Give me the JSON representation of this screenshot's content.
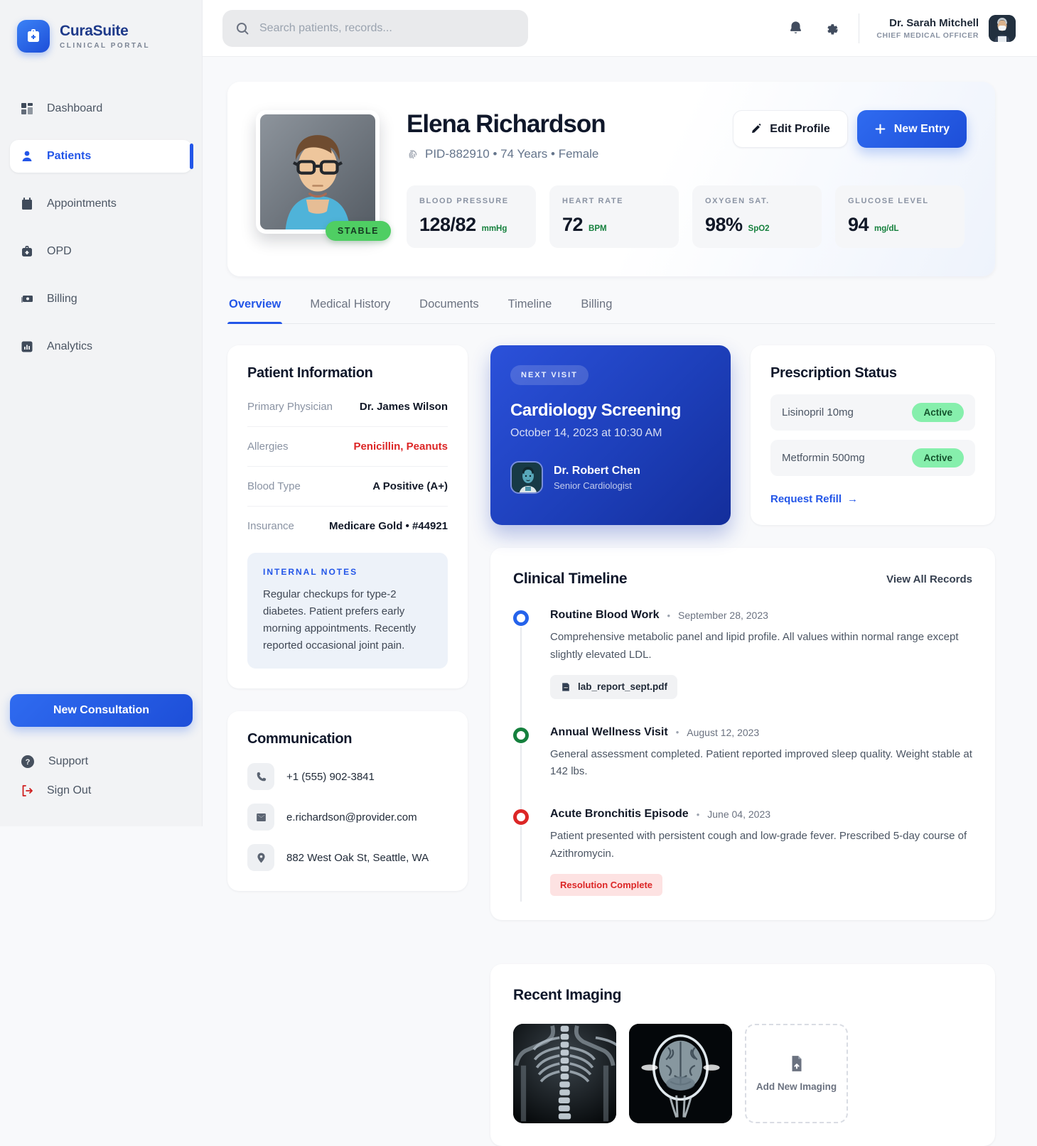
{
  "app": {
    "name": "CuraSuite",
    "tagline": "CLINICAL PORTAL"
  },
  "header": {
    "search_placeholder": "Search patients, records...",
    "user": {
      "name": "Dr. Sarah Mitchell",
      "role": "CHIEF MEDICAL OFFICER"
    }
  },
  "sidebar": {
    "items": [
      {
        "label": "Dashboard"
      },
      {
        "label": "Patients"
      },
      {
        "label": "Appointments"
      },
      {
        "label": "OPD"
      },
      {
        "label": "Billing"
      },
      {
        "label": "Analytics"
      }
    ],
    "cta_label": "New Consultation",
    "support_label": "Support",
    "signout_label": "Sign Out"
  },
  "patient": {
    "name": "Elena Richardson",
    "meta": "PID-882910 • 74 Years • Female",
    "status": "STABLE",
    "edit_label": "Edit Profile",
    "new_entry_label": "New Entry"
  },
  "vitals": [
    {
      "label": "BLOOD PRESSURE",
      "value": "128/82",
      "unit": "mmHg"
    },
    {
      "label": "HEART RATE",
      "value": "72",
      "unit": "BPM"
    },
    {
      "label": "OXYGEN SAT.",
      "value": "98%",
      "unit": "SpO2"
    },
    {
      "label": "GLUCOSE LEVEL",
      "value": "94",
      "unit": "mg/dL"
    }
  ],
  "tabs": [
    {
      "label": "Overview"
    },
    {
      "label": "Medical History"
    },
    {
      "label": "Documents"
    },
    {
      "label": "Timeline"
    },
    {
      "label": "Billing"
    }
  ],
  "patient_info": {
    "title": "Patient Information",
    "rows": [
      {
        "label": "Primary Physician",
        "value": "Dr. James Wilson"
      },
      {
        "label": "Allergies",
        "value": "Penicillin, Peanuts"
      },
      {
        "label": "Blood Type",
        "value": "A Positive (A+)"
      },
      {
        "label": "Insurance",
        "value": "Medicare Gold • #44921"
      }
    ],
    "notes_title": "INTERNAL NOTES",
    "notes_body": "Regular checkups for type-2 diabetes. Patient prefers early morning appointments. Recently reported occasional joint pain."
  },
  "next_visit": {
    "badge": "NEXT VISIT",
    "title": "Cardiology Screening",
    "datetime": "October 14, 2023 at 10:30 AM",
    "doctor": "Dr. Robert Chen",
    "doctor_role": "Senior Cardiologist"
  },
  "prescriptions": {
    "title": "Prescription Status",
    "items": [
      {
        "name": "Lisinopril 10mg",
        "status": "Active"
      },
      {
        "name": "Metformin 500mg",
        "status": "Active"
      }
    ],
    "link_label": "Request Refill"
  },
  "timeline": {
    "title": "Clinical Timeline",
    "link_label": "View All Records",
    "events": [
      {
        "title": "Routine Blood Work",
        "date": "September 28, 2023",
        "desc": "Comprehensive metabolic panel and lipid profile. All values within normal range except slightly elevated LDL.",
        "attachment": "lab_report_sept.pdf"
      },
      {
        "title": "Annual Wellness Visit",
        "date": "August 12, 2023",
        "desc": "General assessment completed. Patient reported improved sleep quality. Weight stable at 142 lbs."
      },
      {
        "title": "Acute Bronchitis Episode",
        "date": "June 04, 2023",
        "desc": "Patient presented with persistent cough and low-grade fever. Prescribed 5-day course of Azithromycin.",
        "flag": "Resolution Complete"
      }
    ]
  },
  "communication": {
    "title": "Communication",
    "items": [
      {
        "value": "+1 (555) 902-3841"
      },
      {
        "value": "e.richardson@provider.com"
      },
      {
        "value": "882 West Oak St, Seattle, WA"
      }
    ]
  },
  "imaging": {
    "title": "Recent Imaging",
    "add_label": "Add New Imaging"
  },
  "ui": {
    "dot": "•",
    "arrow": "→"
  },
  "colors": {
    "accent": "#2356e8",
    "success": "#4fce63",
    "danger": "#dc2626",
    "active_pill": "#86efac"
  }
}
